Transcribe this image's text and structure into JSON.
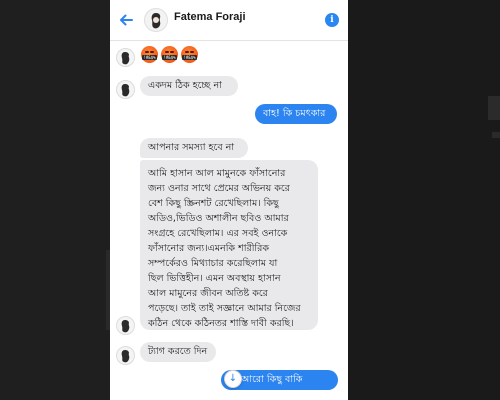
{
  "header": {
    "contact_name": "Fatema Foraji",
    "back_icon": "arrow-left-icon",
    "info_icon": "info-icon",
    "info_glyph": "i"
  },
  "colors": {
    "accent": "#2b84ef",
    "incoming_bubble": "#e9e9eb",
    "outgoing_bubble": "#2b84ef"
  },
  "messages": [
    {
      "from": "contact",
      "type": "emoji",
      "count": 3,
      "icon": "angry-censored-face-emoji",
      "glyph": "!#&$%"
    },
    {
      "from": "contact",
      "type": "text",
      "text": "একদম ঠিক হচ্ছে না"
    },
    {
      "from": "me",
      "type": "text",
      "text": "বাহ! কি চমৎকার"
    },
    {
      "from": "contact",
      "type": "text",
      "text": "আপনার সমস্যা হবে না"
    },
    {
      "from": "contact",
      "type": "text",
      "lines": [
        "আমি হাসান আল মামুনকে ফাঁসানোর",
        "জন্য ওনার সাথে প্রেমের অভিনয় করে",
        "বেশ কিছু স্ক্রিনশট রেখেছিলাম। কিছু",
        "অডিও,ভিডিও অশালীন ছবিও আমার",
        "সংগ্রহে রেখেছিলাম। এর সবই ওনাকে",
        "ফাঁসানোর জন্য।এমনকি শারীরিক",
        "সম্পর্কেরও মিথ্যাচার করেছিলাম যা",
        "ছিল ভিত্তিহীন। এমন অবস্থায় হাসান",
        "আল মামুনের জীবন অতিষ্ট করে",
        "পড়েছে। তাই তাই সজ্ঞানে আমার নিজের",
        "কঠিন থেকে কঠিনতর শাস্তি দাবী করছি।"
      ]
    },
    {
      "from": "contact",
      "type": "text",
      "text": "ট্যাগ করতে দিন"
    },
    {
      "from": "me",
      "type": "text",
      "text": "আরো কিছু বাকি আছে?"
    }
  ],
  "scroll_down_icon": "arrow-down-icon",
  "scroll_down_glyph": "↓"
}
